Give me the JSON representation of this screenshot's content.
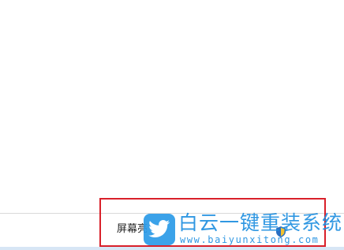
{
  "taskbar": {
    "brightness_label": "屏幕亮"
  },
  "watermark": {
    "title": "白云一键重装系统",
    "url": "www.baiyunxitong.com",
    "logo_icon": "bird-icon",
    "color": "#1f8fe0"
  },
  "highlight": {
    "color": "#d9202a"
  },
  "tray": {
    "shield_icon": "shield-icon"
  }
}
